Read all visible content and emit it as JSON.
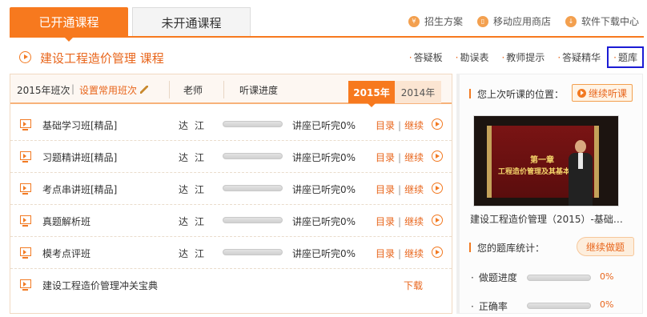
{
  "tabs": [
    {
      "label": "已开通课程",
      "active": true
    },
    {
      "label": "未开通课程",
      "active": false
    }
  ],
  "top_links": [
    {
      "label": "招生方案",
      "icon": "coin-icon"
    },
    {
      "label": "移动应用商店",
      "icon": "phone-icon"
    },
    {
      "label": "软件下载中心",
      "icon": "download-icon"
    }
  ],
  "course": {
    "title": "建设工程造价管理  课程"
  },
  "sub_links": [
    "答疑板",
    "勘误表",
    "教师提示",
    "答疑精华",
    "题库"
  ],
  "table": {
    "class_label": "2015年班次",
    "set_common": "设置常用班次",
    "teacher_header": "老师",
    "progress_header": "听课进度",
    "years": [
      "2015年",
      "2014年"
    ],
    "rows": [
      {
        "name": "基础学习班[精品]",
        "teacher": "达江",
        "progress_text": "讲座已听完0%",
        "progress": 0,
        "catalog": "目录",
        "continue": "继续"
      },
      {
        "name": "习题精讲班[精品]",
        "teacher": "达江",
        "progress_text": "讲座已听完0%",
        "progress": 0,
        "catalog": "目录",
        "continue": "继续"
      },
      {
        "name": "考点串讲班[精品]",
        "teacher": "达江",
        "progress_text": "讲座已听完0%",
        "progress": 0,
        "catalog": "目录",
        "continue": "继续"
      },
      {
        "name": "真题解析班",
        "teacher": "达江",
        "progress_text": "讲座已听完0%",
        "progress": 0,
        "catalog": "目录",
        "continue": "继续"
      },
      {
        "name": "模考点评班",
        "teacher": "达江",
        "progress_text": "讲座已听完0%",
        "progress": 0,
        "catalog": "目录",
        "continue": "继续"
      }
    ],
    "download_row": {
      "name": "建设工程造价管理冲关宝典",
      "action": "下载"
    }
  },
  "right_panel": {
    "last_position": "您上次听课的位置：",
    "continue_btn": "继续听课",
    "video_chapter": "第一章",
    "video_title": "工程造价管理及其基本制",
    "video_caption": "建设工程造价管理（2015）-基础…",
    "stats_title": "您的题库统计：",
    "practice_btn": "继续做题",
    "stats": [
      {
        "label": "做题进度",
        "value": "0%",
        "progress": 0
      },
      {
        "label": "正确率",
        "value": "0%",
        "progress": 0
      }
    ]
  }
}
